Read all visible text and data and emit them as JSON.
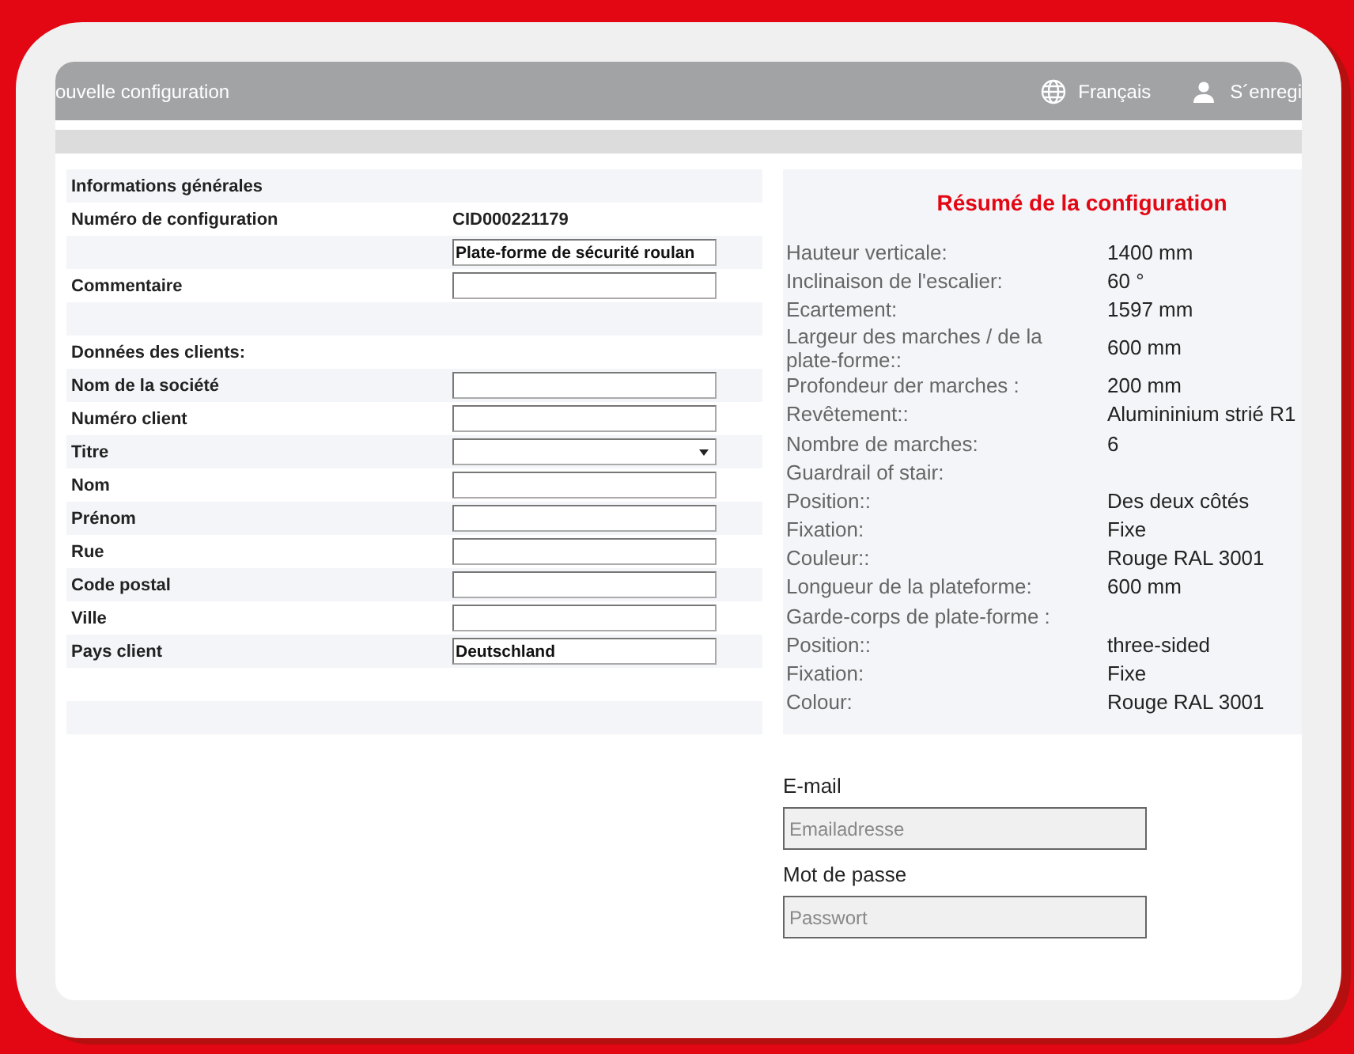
{
  "header": {
    "title": "ouvelle configuration",
    "language": "Français",
    "account": "S´enregi"
  },
  "form": {
    "rows": [
      {
        "kind": "header",
        "label": "Informations générales"
      },
      {
        "kind": "text",
        "label": "Numéro de configuration",
        "value": "CID000221179"
      },
      {
        "kind": "input",
        "label": "",
        "value": "Plate-forme de sécurité roulan"
      },
      {
        "kind": "input",
        "label": "Commentaire",
        "value": ""
      },
      {
        "kind": "blank"
      },
      {
        "kind": "header",
        "label": "Données des clients:"
      },
      {
        "kind": "input",
        "label": "Nom de la société",
        "value": ""
      },
      {
        "kind": "input",
        "label": "Numéro client",
        "value": ""
      },
      {
        "kind": "select",
        "label": "Titre",
        "value": ""
      },
      {
        "kind": "input",
        "label": "Nom",
        "value": ""
      },
      {
        "kind": "input",
        "label": "Prénom",
        "value": ""
      },
      {
        "kind": "input",
        "label": "Rue",
        "value": ""
      },
      {
        "kind": "input",
        "label": "Code postal",
        "value": ""
      },
      {
        "kind": "input",
        "label": "Ville",
        "value": ""
      },
      {
        "kind": "input",
        "label": "Pays client",
        "value": "Deutschland"
      },
      {
        "kind": "blank"
      },
      {
        "kind": "blank"
      }
    ]
  },
  "summary": {
    "title": "Résumé de la configuration",
    "rows": [
      {
        "label": "Hauteur verticale:",
        "value": "1400 mm"
      },
      {
        "label": "Inclinaison de l'escalier:",
        "value": "60 °"
      },
      {
        "label": "Ecartement:",
        "value": "1597 mm"
      },
      {
        "label": "Largeur des marches / de la plate-forme::",
        "value": "600 mm"
      },
      {
        "label": "Profondeur der marches :",
        "value": "200 mm"
      },
      {
        "label": "Revêtement::",
        "value": "Alumininium strié R1"
      },
      {
        "label": "Nombre de marches:",
        "value": "6"
      },
      {
        "label": "Guardrail of stair:",
        "value": ""
      },
      {
        "label": "Position::",
        "value": "Des deux côtés"
      },
      {
        "label": "Fixation:",
        "value": "Fixe"
      },
      {
        "label": "Couleur::",
        "value": "Rouge RAL 3001"
      },
      {
        "label": "Longueur de la plateforme:",
        "value": "600 mm"
      },
      {
        "label": "Garde-corps de plate-forme :",
        "value": ""
      },
      {
        "label": "Position::",
        "value": "three-sided"
      },
      {
        "label": "Fixation:",
        "value": "Fixe"
      },
      {
        "label": "Colour:",
        "value": "Rouge RAL 3001"
      }
    ]
  },
  "login": {
    "email_label": "E-mail",
    "email_placeholder": "Emailadresse",
    "password_label": "Mot de passe",
    "password_placeholder": "Passwort"
  }
}
